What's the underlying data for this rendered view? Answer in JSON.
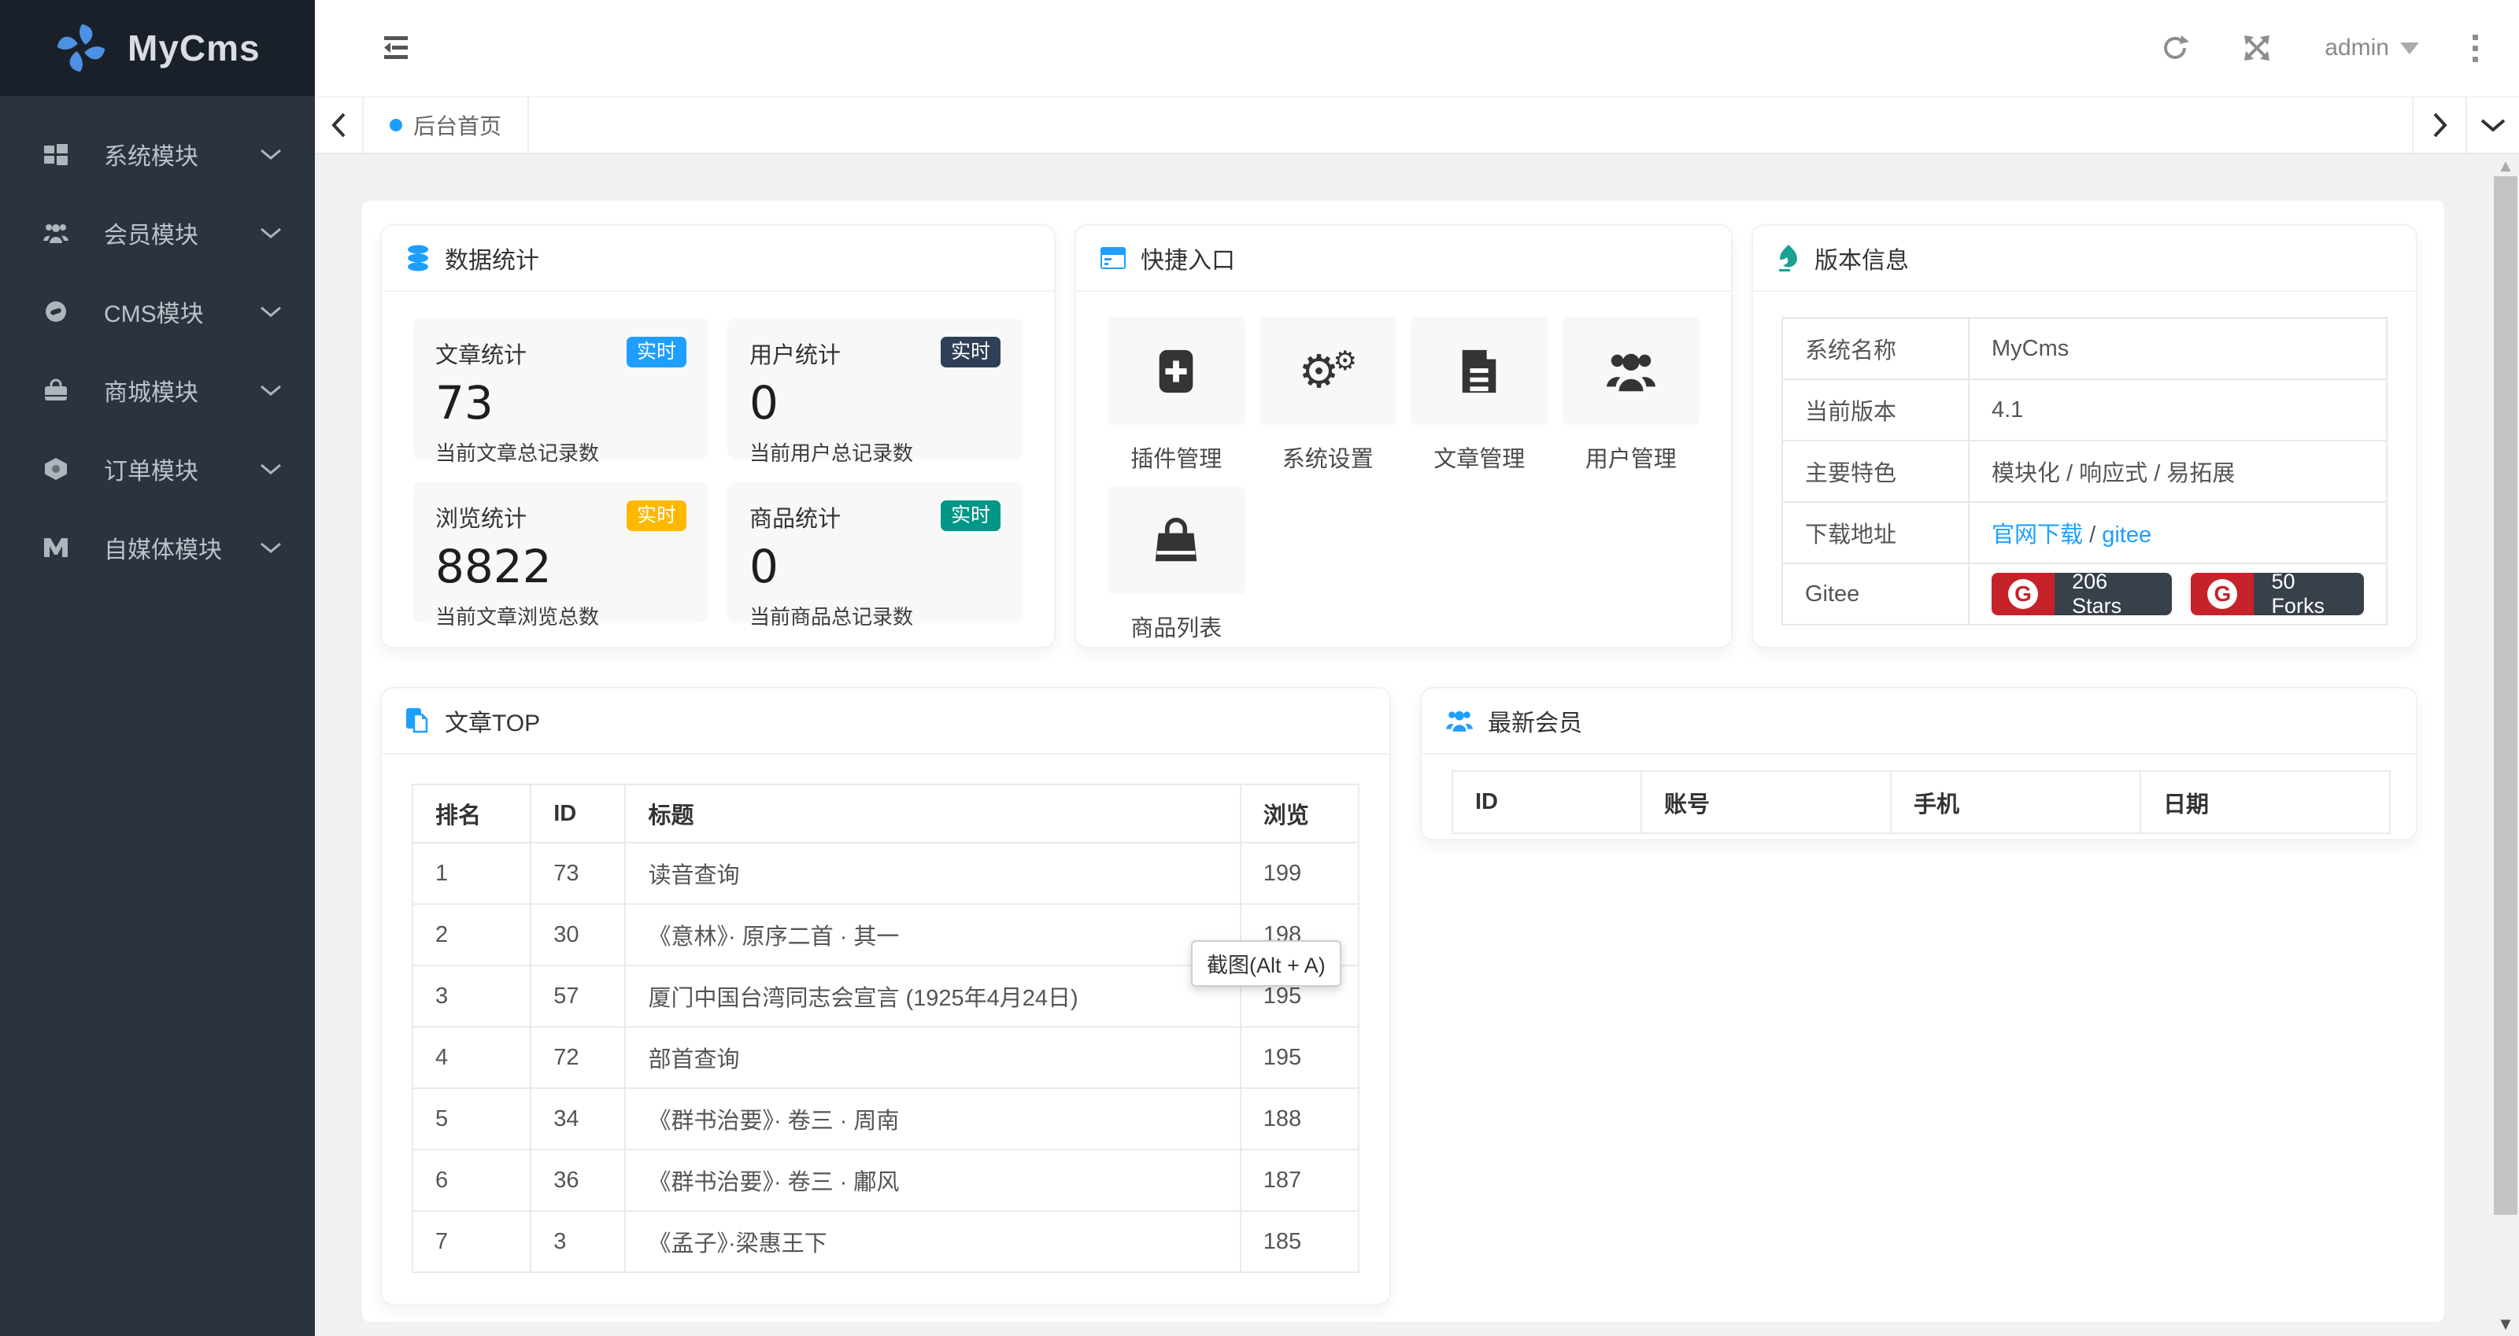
{
  "brand": {
    "name": "MyCms"
  },
  "topbar": {
    "username": "admin"
  },
  "tabbar": {
    "active_tab": "后台首页"
  },
  "sidebar": {
    "items": [
      {
        "label": "系统模块"
      },
      {
        "label": "会员模块"
      },
      {
        "label": "CMS模块"
      },
      {
        "label": "商城模块"
      },
      {
        "label": "订单模块"
      },
      {
        "label": "自媒体模块"
      }
    ]
  },
  "colors": {
    "accent_blue": "#1E9FFF",
    "badge_dark": "#2F4056",
    "badge_yellow": "#FFB800",
    "badge_green": "#009688",
    "teal_icon": "#1AA094",
    "gitee_red": "#C6222A",
    "gitee_label_bg": "#38414A",
    "sidebar_bg": "#2A333E",
    "logo_bg": "#1A2029"
  },
  "stats": {
    "title": "数据统计",
    "cards": [
      {
        "label": "文章统计",
        "badge": "实时",
        "value": "73",
        "desc": "当前文章总记录数"
      },
      {
        "label": "用户统计",
        "badge": "实时",
        "value": "0",
        "desc": "当前用户总记录数"
      },
      {
        "label": "浏览统计",
        "badge": "实时",
        "value": "8822",
        "desc": "当前文章浏览总数"
      },
      {
        "label": "商品统计",
        "badge": "实时",
        "value": "0",
        "desc": "当前商品总记录数"
      }
    ]
  },
  "shortcuts": {
    "title": "快捷入口",
    "items": [
      {
        "label": "插件管理"
      },
      {
        "label": "系统设置"
      },
      {
        "label": "文章管理"
      },
      {
        "label": "用户管理"
      },
      {
        "label": "商品列表"
      }
    ]
  },
  "version": {
    "title": "版本信息",
    "labels": [
      "系统名称",
      "当前版本",
      "主要特色",
      "下载地址",
      "Gitee"
    ],
    "system_name": "MyCms",
    "current_version": "4.1",
    "features": "模块化 / 响应式 / 易拓展",
    "download": {
      "link1": "官网下载",
      "sep": " / ",
      "link2": "gitee"
    },
    "gitee_badges": [
      {
        "g": "G",
        "text": "206 Stars"
      },
      {
        "g": "G",
        "text": "50 Forks"
      }
    ]
  },
  "articles": {
    "title": "文章TOP",
    "headers": [
      "排名",
      "ID",
      "标题",
      "浏览"
    ],
    "rows": [
      [
        "1",
        "73",
        "读音查询",
        "199"
      ],
      [
        "2",
        "30",
        "《意林》· 原序二首 · 其一",
        "198"
      ],
      [
        "3",
        "57",
        "厦门中国台湾同志会宣言 (1925年4月24日)",
        "195"
      ],
      [
        "4",
        "72",
        "部首查询",
        "195"
      ],
      [
        "5",
        "34",
        "《群书治要》· 卷三 · 周南",
        "188"
      ],
      [
        "6",
        "36",
        "《群书治要》· 卷三 · 鄘风",
        "187"
      ],
      [
        "7",
        "3",
        "《孟子》·梁惠王下",
        "185"
      ]
    ]
  },
  "members": {
    "title": "最新会员",
    "headers": [
      "ID",
      "账号",
      "手机",
      "日期"
    ]
  },
  "tooltip": {
    "text": "截图(Alt + A)"
  }
}
